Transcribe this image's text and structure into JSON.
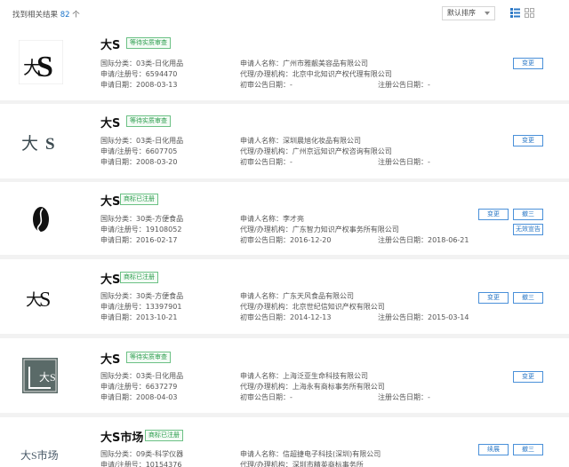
{
  "header": {
    "result_prefix": "找到相关结果",
    "result_count": "82",
    "result_suffix": "个",
    "sort_label": "默认排序"
  },
  "icons": {
    "list_view": "list-view-icon",
    "grid_view": "grid-view-icon",
    "dropdown": "chevron-down-icon"
  },
  "colors": {
    "link_blue": "#2b78c6",
    "badge_green": "#2e9e4f",
    "page_bg": "#f2f2f2"
  },
  "results": [
    {
      "name": "大S",
      "status": "等待实质审查",
      "logo_text": "大S",
      "class_label": "国际分类：03类-日化用品",
      "reg_label": "申请/注册号：6594470",
      "date_label": "申请日期：2008-03-13",
      "applicant_label": "申请人名称：广州市雅靓美容品有限公司",
      "agent_label": "代理/办理机构：北京中北知识产权代理有限公司",
      "prelim_label": "初审公告日期：-",
      "regdate_label": "注册公告日期：-",
      "buttons": [
        "变更"
      ]
    },
    {
      "name": "大S",
      "status": "等待实质审查",
      "logo_text": "大 S",
      "class_label": "国际分类：03类-日化用品",
      "reg_label": "申请/注册号：6607705",
      "date_label": "申请日期：2008-03-20",
      "applicant_label": "申请人名称：深圳晨旭化妆品有限公司",
      "agent_label": "代理/办理机构：广州京远知识产权咨询有限公司",
      "prelim_label": "初审公告日期：-",
      "regdate_label": "注册公告日期：-",
      "buttons": [
        "变更"
      ]
    },
    {
      "name": "大S",
      "status": "商标已注册",
      "logo_text": "",
      "class_label": "国际分类：30类-方便食品",
      "reg_label": "申请/注册号：19108052",
      "date_label": "申请日期：2016-02-17",
      "applicant_label": "申请人名称：李才亮",
      "agent_label": "代理/办理机构：广东智力知识产权事务所有限公司",
      "prelim_label": "初审公告日期：2016-12-20",
      "regdate_label": "注册公告日期：2018-06-21",
      "buttons": [
        "变更",
        "撤三",
        "无效宣告"
      ]
    },
    {
      "name": "大S",
      "status": "商标已注册",
      "logo_text": "大S",
      "class_label": "国际分类：30类-方便食品",
      "reg_label": "申请/注册号：13397901",
      "date_label": "申请日期：2013-10-21",
      "applicant_label": "申请人名称：广东天风食品有限公司",
      "agent_label": "代理/办理机构：北京世纪信知识产权有限公司",
      "prelim_label": "初审公告日期：2014-12-13",
      "regdate_label": "注册公告日期：2015-03-14",
      "buttons": [
        "变更",
        "撤三"
      ]
    },
    {
      "name": "大S",
      "status": "等待实质审查",
      "logo_text": "大S",
      "class_label": "国际分类：03类-日化用品",
      "reg_label": "申请/注册号：6637279",
      "date_label": "申请日期：2008-04-03",
      "applicant_label": "申请人名称：上海泛亚生命科技有限公司",
      "agent_label": "代理/办理机构：上海永有商标事务所有限公司",
      "prelim_label": "初审公告日期：-",
      "regdate_label": "注册公告日期：-",
      "buttons": [
        "变更"
      ]
    },
    {
      "name": "大S市场",
      "status": "商标已注册",
      "logo_text": "大S市场",
      "class_label": "国际分类：09类-科学仪器",
      "reg_label": "申请/注册号：10154376",
      "applicant_label": "申请人名称：信超捷电子科技(深圳)有限公司",
      "agent_label": "代理/办理机构：深圳市精英商标事务所",
      "buttons": [
        "续展",
        "撤三"
      ]
    }
  ]
}
